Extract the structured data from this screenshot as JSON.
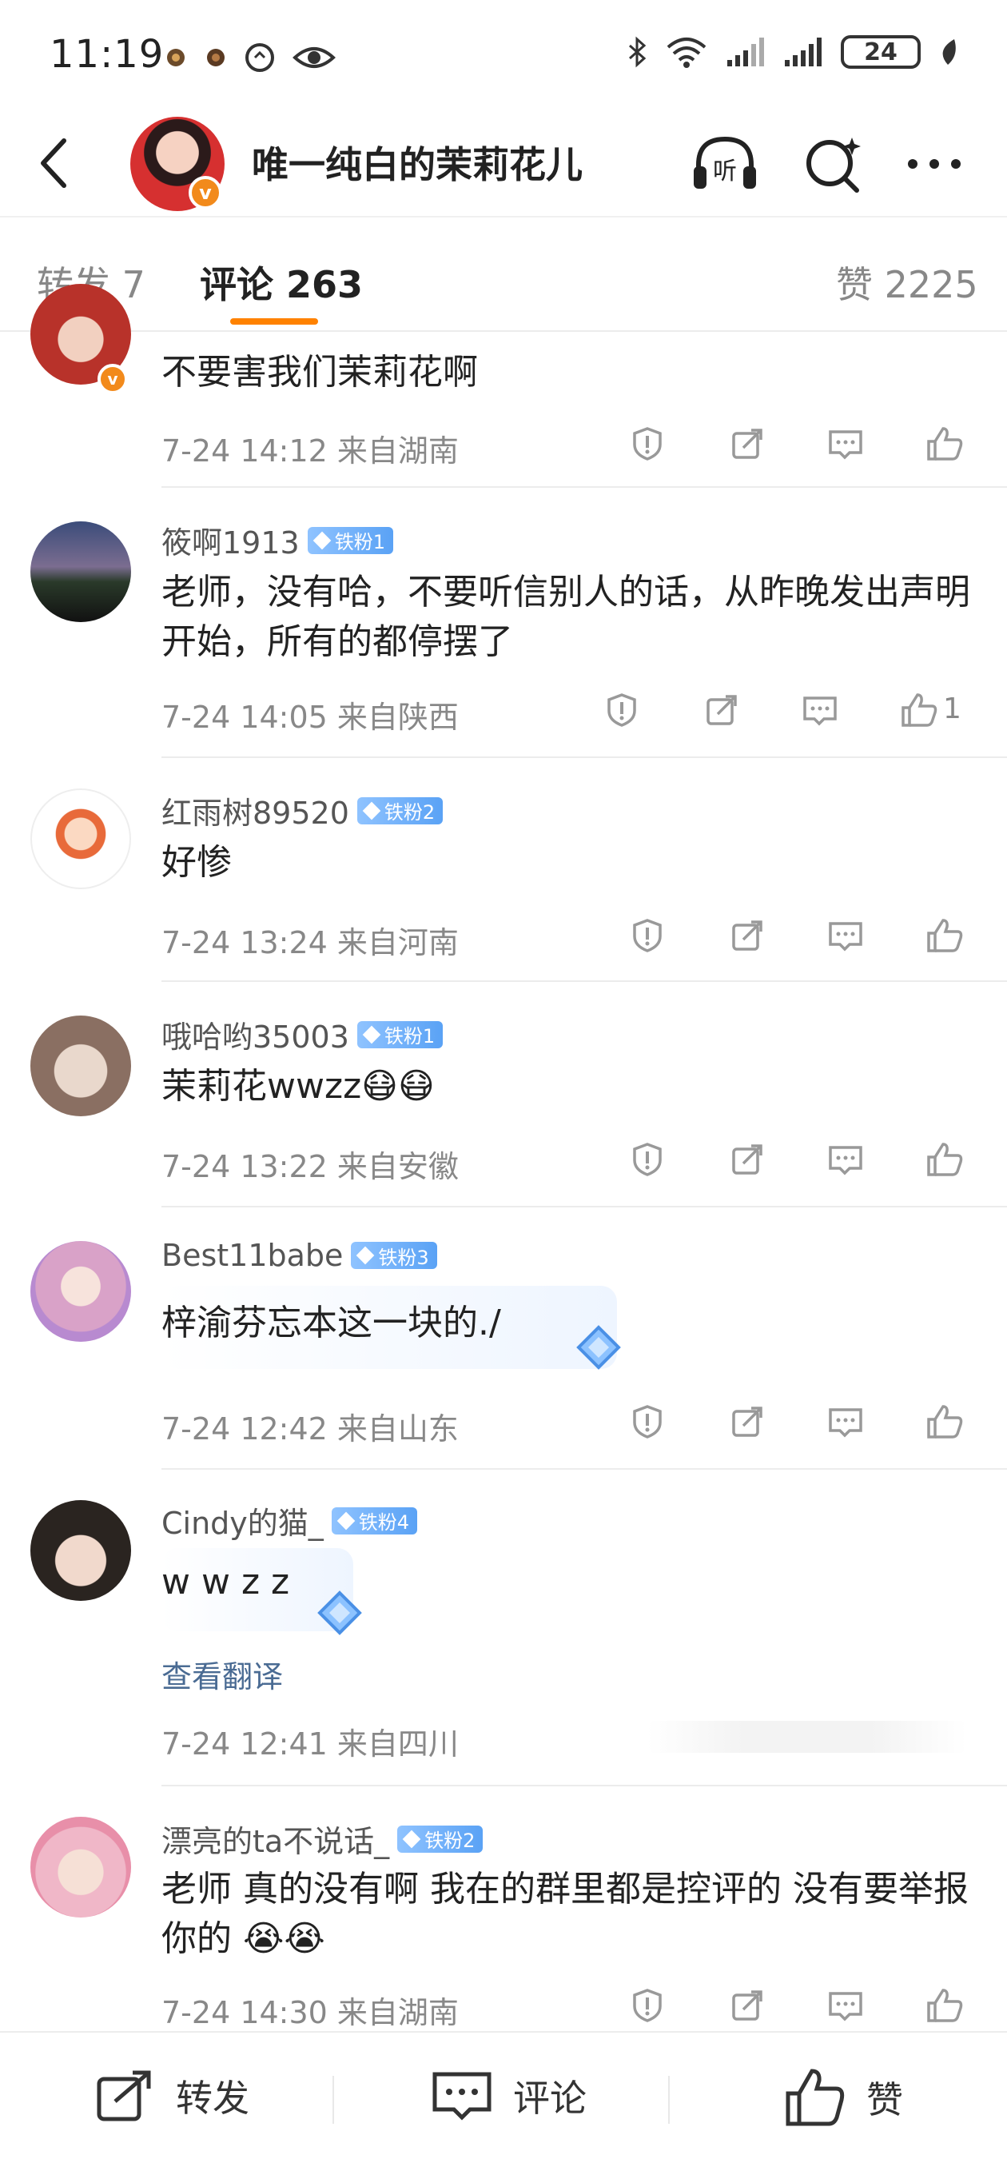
{
  "status_bar": {
    "time": "11:19",
    "battery": "24"
  },
  "header": {
    "title": "唯一纯白的茉莉花儿",
    "verified_badge": "v"
  },
  "tabs": {
    "repost": "转发 7",
    "comments": "评论 263",
    "likes": "赞 2225"
  },
  "comments": [
    {
      "name": "",
      "fan_badge": "",
      "text": "不要害我们茉莉花啊",
      "meta": "7-24 14:12  来自湖南",
      "like_count": ""
    },
    {
      "name": "筱啊1913",
      "fan_badge": "铁粉1",
      "text": "老师，没有哈，不要听信别人的话，从昨晚发出声明开始，所有的都停摆了",
      "meta": "7-24 14:05  来自陕西",
      "like_count": "1"
    },
    {
      "name": "红雨树89520",
      "fan_badge": "铁粉2",
      "text": "好惨",
      "meta": "7-24 13:24  来自河南",
      "like_count": ""
    },
    {
      "name": "哦哈哟35003",
      "fan_badge": "铁粉1",
      "text": "茉莉花wwzz😷😷",
      "meta": "7-24 13:22  来自安徽",
      "like_count": ""
    },
    {
      "name": "Best11babe",
      "fan_badge": "铁粉3",
      "text": "梓渝芬忘本这一块的./",
      "meta": "7-24 12:42  来自山东",
      "like_count": ""
    },
    {
      "name": "Cindy的猫_",
      "fan_badge": "铁粉4",
      "text": "w w z z",
      "translate": "查看翻译",
      "meta": "7-24 12:41  来自四川",
      "like_count": ""
    },
    {
      "name": "漂亮的ta不说话_",
      "fan_badge": "铁粉2",
      "text": "老师 真的没有啊 我在的群里都是控评的 没有要举报你的 😭😭",
      "meta": "7-24 14:30  来自湖南",
      "like_count": ""
    }
  ],
  "bottom_bar": {
    "repost": "转发",
    "comment": "评论",
    "like": "赞"
  },
  "colors": {
    "accent": "#ff8200",
    "fan_badge": "#5aa2f5",
    "link": "#4a6b93"
  },
  "icons": [
    "back-icon",
    "listen-icon",
    "search-icon",
    "more-icon",
    "report-icon",
    "share-icon",
    "comment-icon",
    "like-icon"
  ]
}
